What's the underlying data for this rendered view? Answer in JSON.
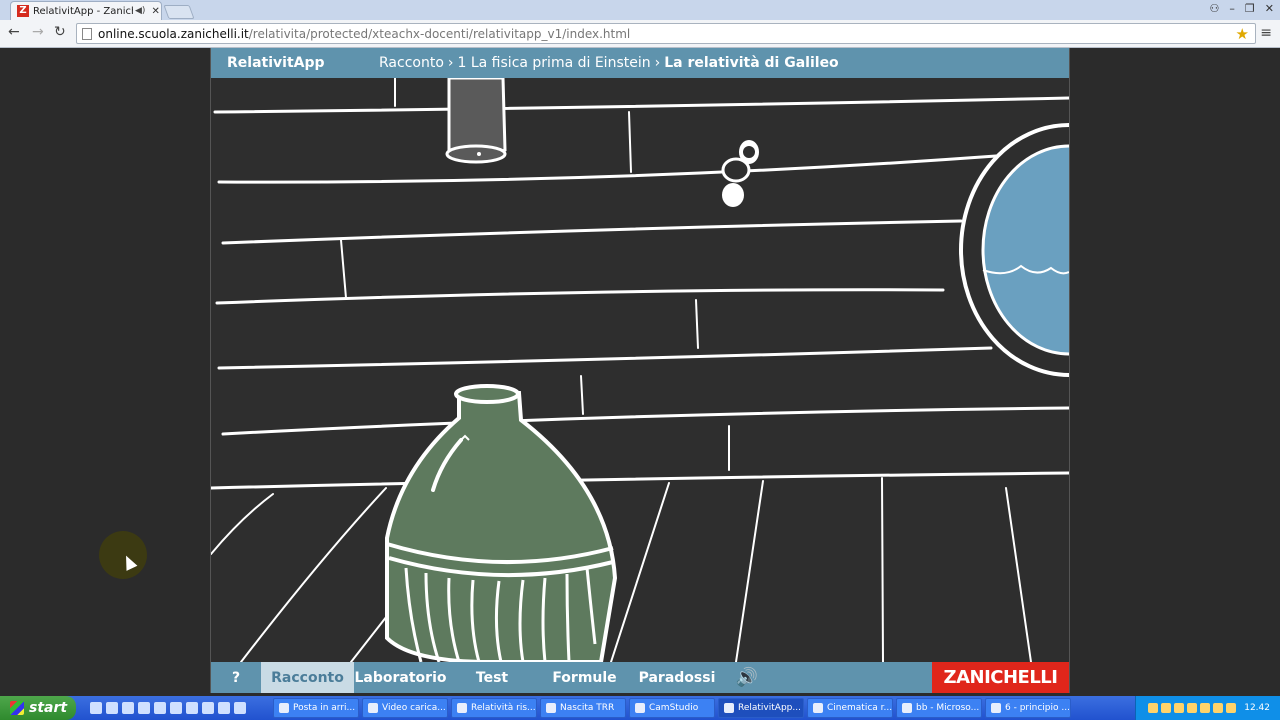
{
  "browser": {
    "tab_title": "RelativitApp - Zanichelli",
    "tab_favicon_letter": "Z",
    "url_host": "online.scuola.zanichelli.it",
    "url_path": "/relativita/protected/xteachx-docenti/relativitapp_v1/index.html"
  },
  "app": {
    "name": "RelativitApp",
    "breadcrumb": [
      "Racconto",
      "1 La fisica prima di Einstein",
      "La relatività di Galileo"
    ],
    "breadcrumb_sep": "›",
    "footer": {
      "help": "?",
      "tabs": [
        "Racconto",
        "Laboratorio",
        "Test",
        "Formule",
        "Paradossi"
      ],
      "active_tab": "Racconto",
      "brand": "ZANICHELLI"
    }
  },
  "taskbar": {
    "start_label": "start",
    "tasks": [
      {
        "label": "Posta in arri...",
        "active": false
      },
      {
        "label": "Video carica...",
        "active": false
      },
      {
        "label": "Relatività ris...",
        "active": false
      },
      {
        "label": "Nascita TRR",
        "active": false
      },
      {
        "label": "CamStudio",
        "active": false
      },
      {
        "label": "RelativitApp...",
        "active": true
      },
      {
        "label": "Cinematica r...",
        "active": false
      },
      {
        "label": "bb - Microso...",
        "active": false
      },
      {
        "label": "6 - principio ...",
        "active": false
      }
    ],
    "clock": "12.42"
  },
  "colors": {
    "header_blue": "#5f93ad",
    "brand_red": "#e0261b",
    "bottle_green": "#5e7a5e",
    "water_blue": "#6aa0c0"
  }
}
